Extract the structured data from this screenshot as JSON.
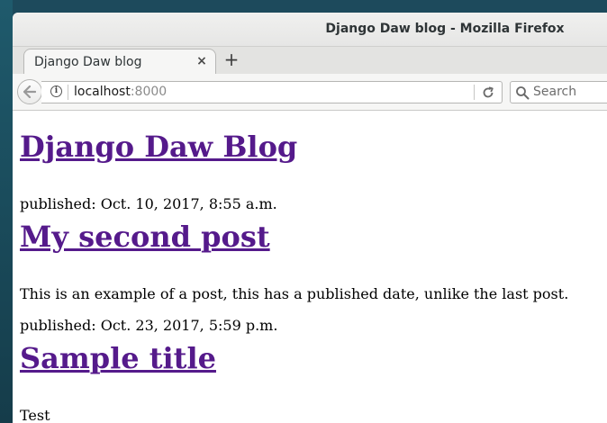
{
  "window": {
    "title": "Django Daw blog - Mozilla Firefox"
  },
  "tabs": [
    {
      "label": "Django Daw blog",
      "close": "×"
    }
  ],
  "new_tab_label": "+",
  "url": {
    "host": "localhost",
    "port": ":8000"
  },
  "search": {
    "placeholder": "Search"
  },
  "page": {
    "blog_title": "Django Daw Blog",
    "posts": [
      {
        "published": "published: Oct. 10, 2017, 8:55 a.m."
      },
      {
        "title": "My second post",
        "body": "This is an example of a post, this has a published date, unlike the last post.",
        "published": "published: Oct. 23, 2017, 5:59 p.m."
      },
      {
        "title": "Sample title",
        "body": "Test"
      }
    ]
  },
  "icons": {
    "back": "back-arrow-icon",
    "info": "info-icon",
    "reload": "reload-icon",
    "search": "search-icon",
    "close": "close-icon",
    "new_tab": "plus-icon"
  },
  "colors": {
    "link_visited": "#551a8b",
    "chrome_bg": "#f6f6f5",
    "desktop_bg": "#1d4a5c"
  }
}
